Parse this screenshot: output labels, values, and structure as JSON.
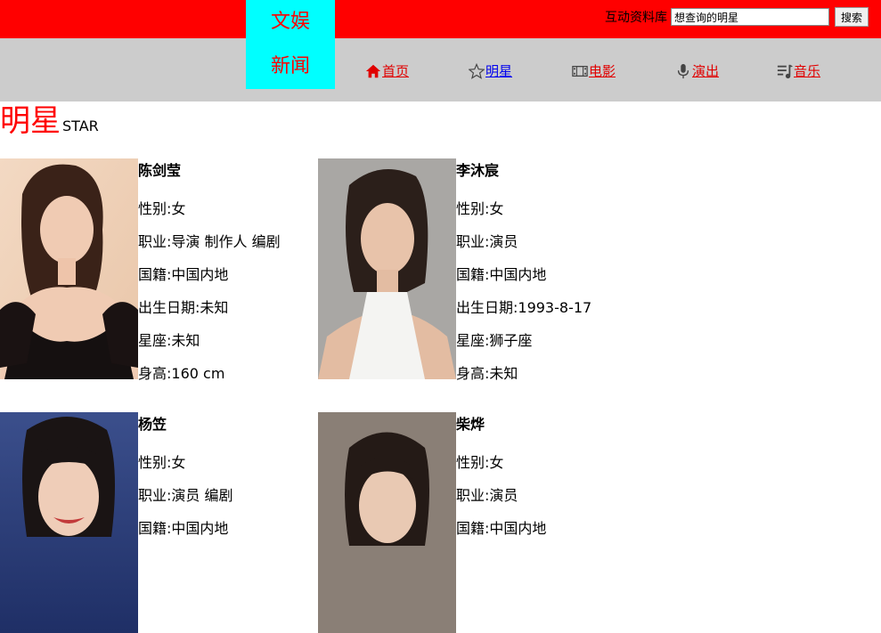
{
  "header": {
    "logo_line1": "文娱",
    "logo_line2": "新闻",
    "search_label": "互动资料库",
    "search_value": "想查询的明星",
    "search_button": "搜索"
  },
  "nav": {
    "home": "首页",
    "stars": "明星",
    "movies": "电影",
    "shows": "演出",
    "music": "音乐"
  },
  "section": {
    "title_cn": "明星",
    "title_en": "STAR"
  },
  "stars": [
    {
      "name": "陈剑莹",
      "gender": "性别:女",
      "job": "职业:导演 制作人 编剧",
      "nationality": "国籍:中国内地",
      "birth": "出生日期:未知",
      "zodiac": "星座:未知",
      "height": "身高:160 cm"
    },
    {
      "name": "李沐宸",
      "gender": "性别:女",
      "job": "职业:演员",
      "nationality": "国籍:中国内地",
      "birth": "出生日期:1993-8-17",
      "zodiac": "星座:狮子座",
      "height": "身高:未知"
    },
    {
      "name": "杨笠",
      "gender": "性别:女",
      "job": "职业:演员 编剧",
      "nationality": "国籍:中国内地"
    },
    {
      "name": "柴烨",
      "gender": "性别:女",
      "job": "职业:演员",
      "nationality": "国籍:中国内地"
    }
  ],
  "colors": {
    "topbar": "#ff0000",
    "logo_bg": "#00ffff",
    "navbar": "#cccccc",
    "accent": "#ff0000"
  }
}
